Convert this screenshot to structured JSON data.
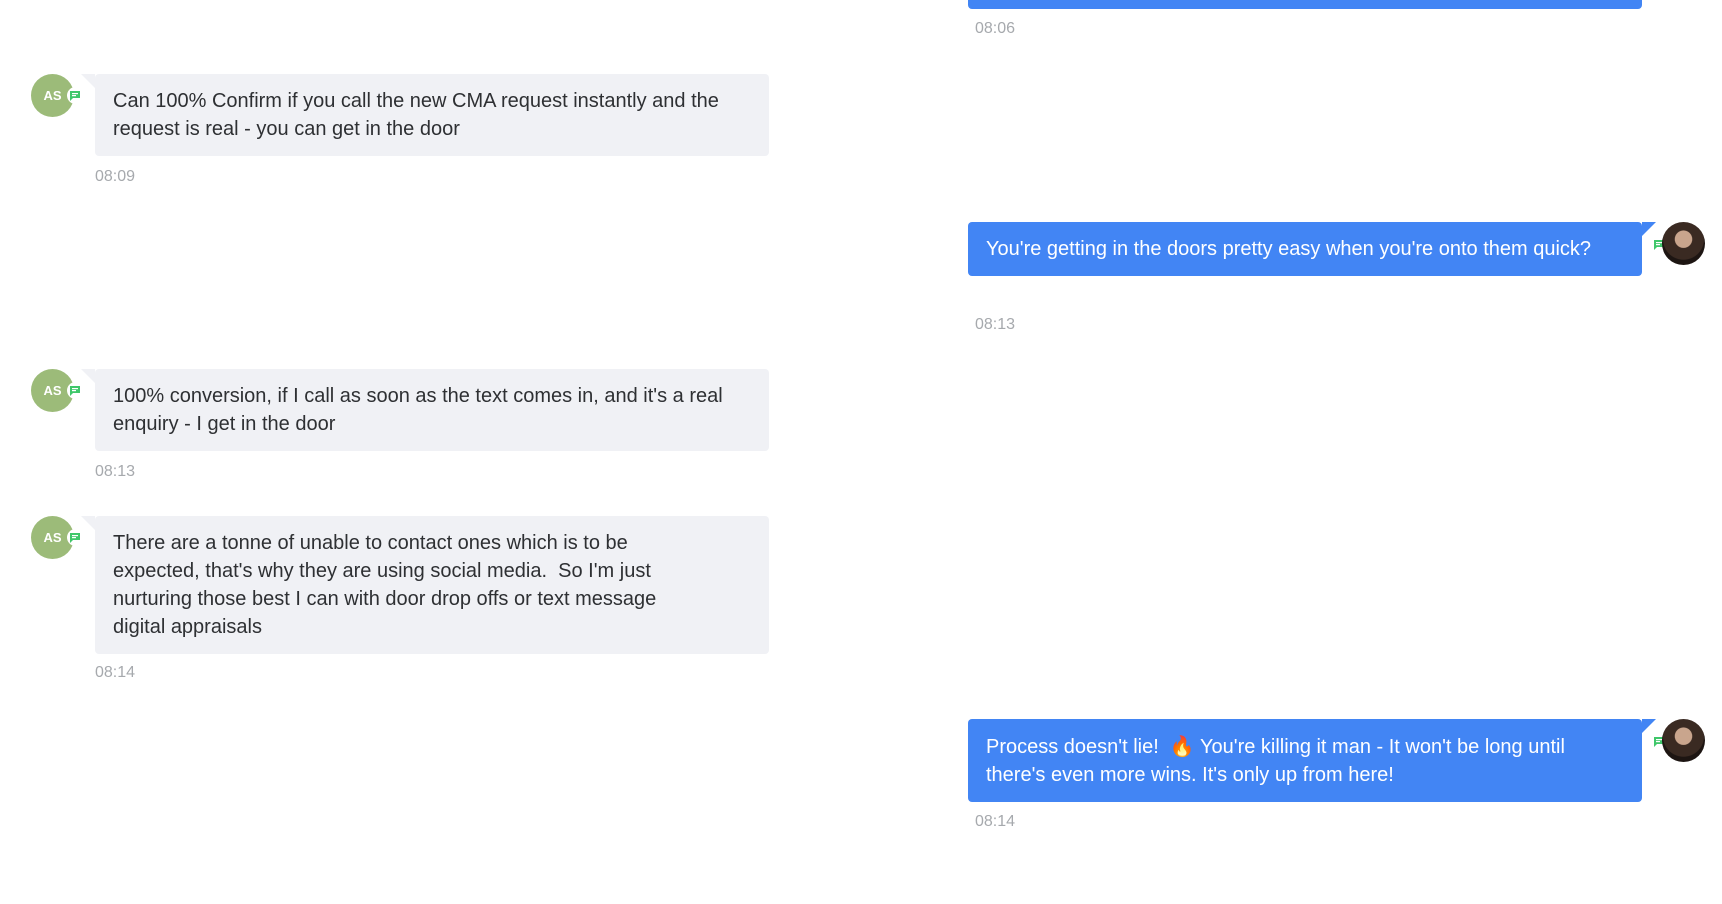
{
  "conversation": {
    "accent_color": "#4285f4",
    "incoming_bubble_color": "#f0f1f5",
    "agent_avatar_color": "#9cbb79",
    "messages": [
      {
        "direction": "outgoing",
        "text": "",
        "time": "08:06"
      },
      {
        "direction": "incoming",
        "avatar_initials": "AS",
        "channel_icon": "sms-icon",
        "text": "Can 100% Confirm if you call the new CMA request instantly and the request is real - you can get in the door",
        "time": "08:09"
      },
      {
        "direction": "outgoing",
        "channel_icon": "sms-icon",
        "text": "You're getting in the doors pretty easy when you're onto them quick?",
        "time": "08:13"
      },
      {
        "direction": "incoming",
        "avatar_initials": "AS",
        "channel_icon": "sms-icon",
        "text": "100% conversion, if I call as soon as the text comes in, and it's a real enquiry - I get in the door",
        "time": "08:13"
      },
      {
        "direction": "incoming",
        "avatar_initials": "AS",
        "channel_icon": "sms-icon",
        "text": "There are a tonne of unable to contact ones which is to be expected, that's why they are using social media.  So I'm just nurturing those best I can with door drop offs or text message digital appraisals",
        "time": "08:14"
      },
      {
        "direction": "outgoing",
        "channel_icon": "sms-icon",
        "text_before_emoji": "Process doesn't lie!  ",
        "emoji": "🔥",
        "text_after_emoji": " You're killing it man - It won't be long until there's even more wins. It's only up from here!",
        "time": "08:14"
      }
    ]
  }
}
